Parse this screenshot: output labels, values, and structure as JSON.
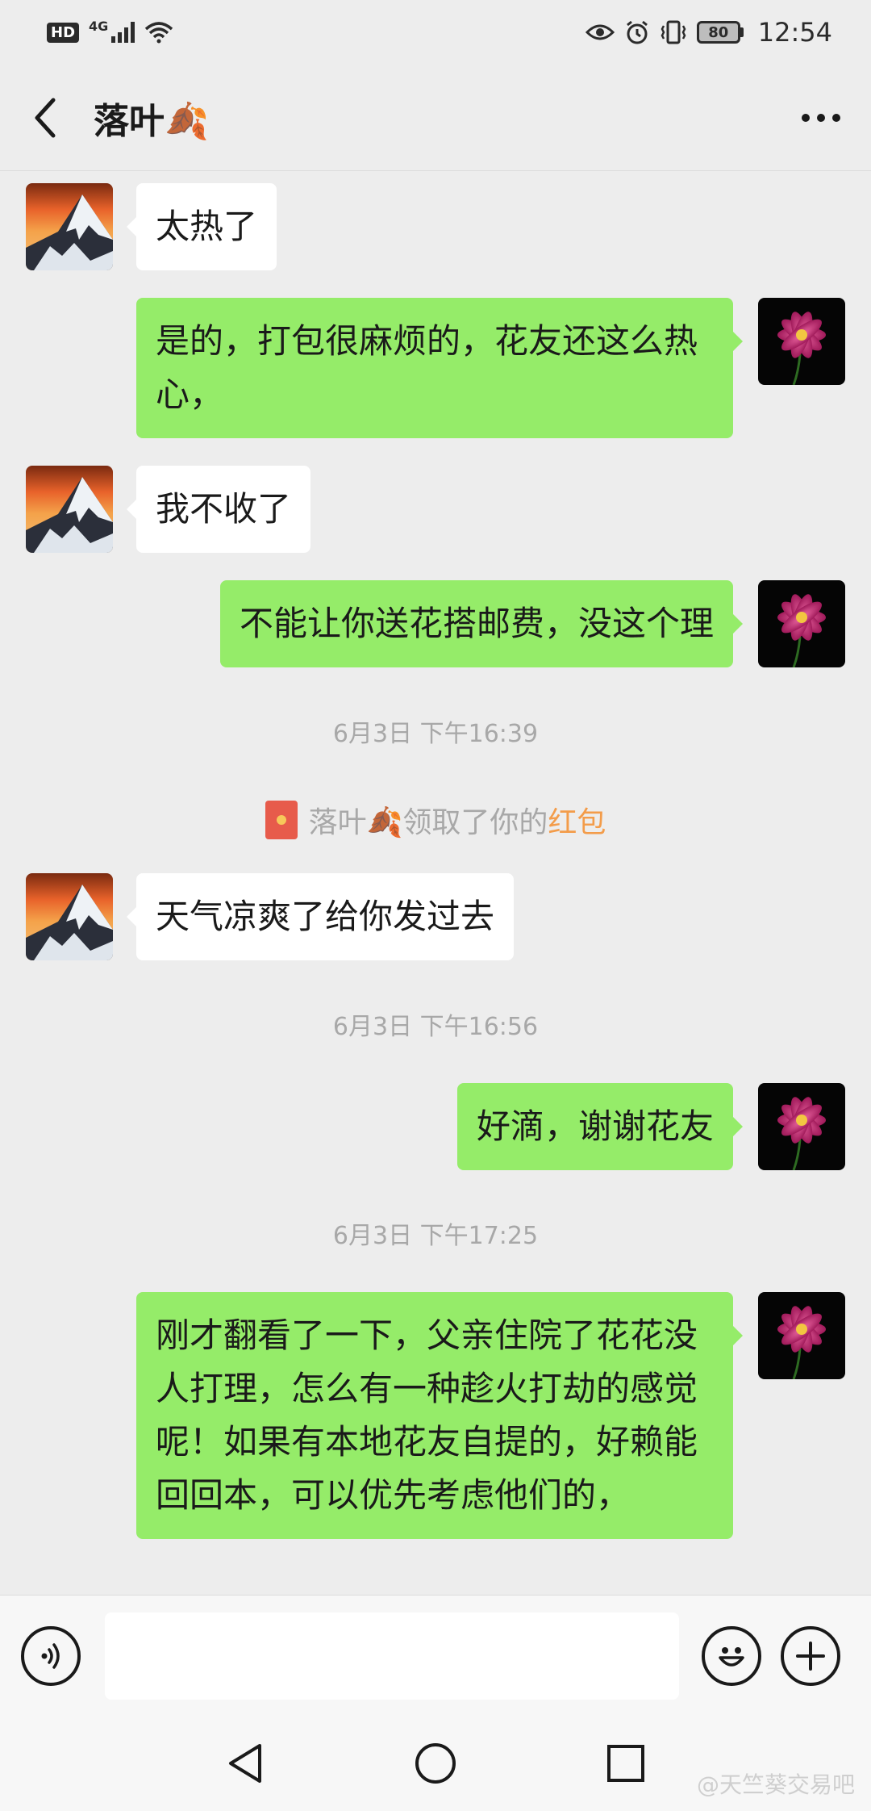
{
  "status_bar": {
    "hd": "HD",
    "network": "4G",
    "battery": "80",
    "time": "12:54"
  },
  "header": {
    "title": "落叶🍂"
  },
  "messages": [
    {
      "text": "太热了"
    },
    {
      "text": "是的，打包很麻烦的，花友还这么热心，"
    },
    {
      "text": "我不收了"
    },
    {
      "text": "不能让你送花搭邮费，没这个理"
    },
    {
      "text": "6月3日 下午16:39"
    },
    {
      "prefix": "落叶🍂领取了你的",
      "link": "红包"
    },
    {
      "text": "天气凉爽了给你发过去"
    },
    {
      "text": "6月3日 下午16:56"
    },
    {
      "text": "好滴，谢谢花友"
    },
    {
      "text": "6月3日 下午17:25"
    },
    {
      "text": "刚才翻看了一下，父亲住院了花花没人打理，怎么有一种趁火打劫的感觉呢！如果有本地花友自提的，好赖能回回本，可以优先考虑他们的，"
    }
  ],
  "watermark": "@天竺葵交易吧",
  "colors": {
    "bubble_out": "#95ec69",
    "bubble_in": "#ffffff",
    "background": "#ededed",
    "link": "#f39c4a"
  },
  "icons": [
    "back-arrow-icon",
    "more-icon",
    "voice-icon",
    "emoji-icon",
    "plus-icon",
    "back-triangle-icon",
    "home-circle-icon",
    "recents-square-icon",
    "red-packet-icon"
  ]
}
